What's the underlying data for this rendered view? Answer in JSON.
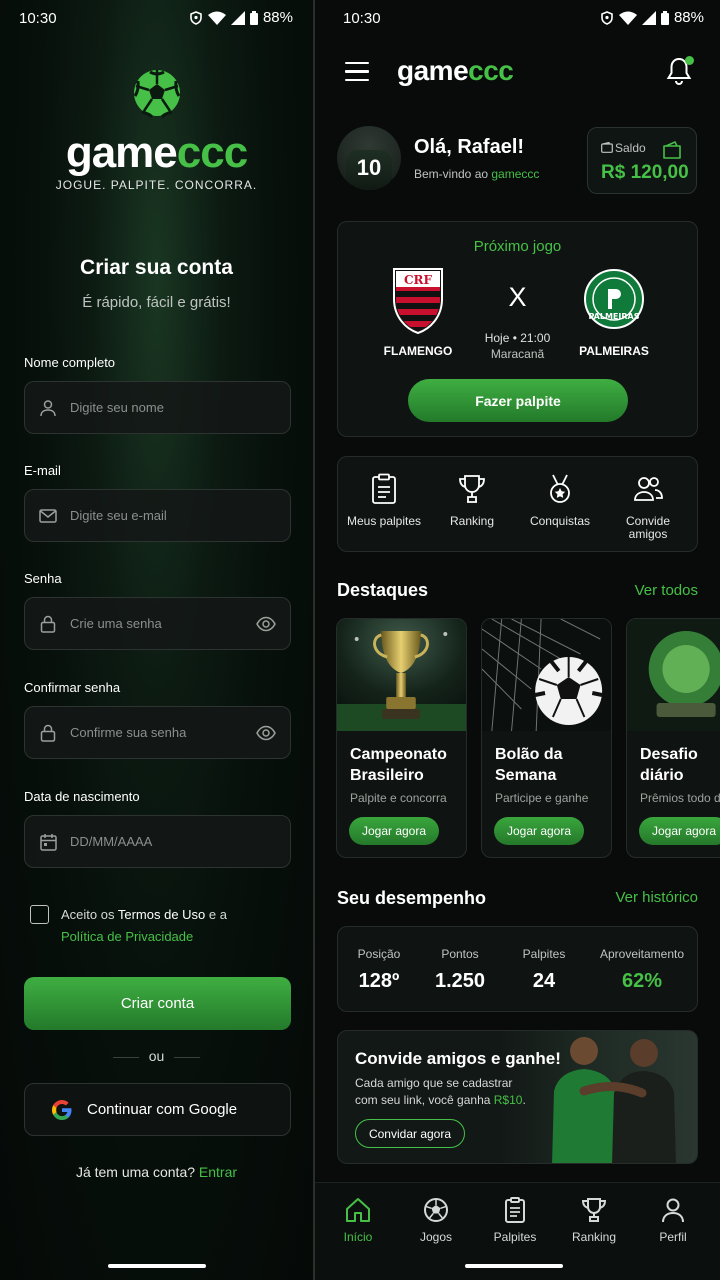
{
  "status_bar": {
    "time": "10:30",
    "battery": "88%"
  },
  "register": {
    "brand": {
      "part1": "game",
      "part2": "ccc",
      "tagline": "JOGUE. PALPITE. CONCORRA."
    },
    "title": "Criar sua conta",
    "subtitle": "É rápido, fácil e grátis!",
    "fields": [
      {
        "label": "Nome completo",
        "placeholder": "Digite seu nome",
        "icon": "user-icon"
      },
      {
        "label": "E-mail",
        "placeholder": "Digite seu e-mail",
        "icon": "mail-icon"
      },
      {
        "label": "Senha",
        "placeholder": "Crie uma senha",
        "icon": "lock-icon"
      },
      {
        "label": "Confirmar senha",
        "placeholder": "Confirme sua senha",
        "icon": "lock-icon"
      },
      {
        "label": "Data de nascimento",
        "placeholder": "DD/MM/AAAA",
        "icon": "calendar-icon"
      }
    ],
    "terms": {
      "prefix": "Aceito os ",
      "terms_link": "Termos de Uso",
      "middle": " e a",
      "privacy_link": "Política de Privacidade"
    },
    "submit_label": "Criar conta",
    "or_label": "ou",
    "google_label": "Continuar com Google",
    "login_prompt": "Já tem uma conta?",
    "login_link": "Entrar"
  },
  "home": {
    "brand": {
      "part1": "game",
      "part2": "ccc"
    },
    "greeting": "Olá, Rafael!",
    "welcome_prefix": "Bem-vindo ao ",
    "welcome_brand": "gameccc",
    "avatar_number": "10",
    "balance": {
      "label": "Saldo",
      "value": "R$ 120,00"
    },
    "next_game": {
      "title": "Próximo jogo",
      "home_team": "FLAMENGO",
      "away_team": "PALMEIRAS",
      "vs": "X",
      "when": "Hoje • 21:00",
      "venue": "Maracanã",
      "cta": "Fazer palpite"
    },
    "quick_actions": [
      {
        "label": "Meus palpites",
        "icon": "clipboard-icon"
      },
      {
        "label": "Ranking",
        "icon": "trophy-icon"
      },
      {
        "label": "Conquistas",
        "icon": "medal-icon"
      },
      {
        "label": "Convide amigos",
        "icon": "friends-icon"
      }
    ],
    "highlights": {
      "title": "Destaques",
      "see_all": "Ver todos",
      "items": [
        {
          "title_line1": "Campeonato",
          "title_line2": "Brasileiro",
          "subtitle": "Palpite e concorra",
          "cta": "Jogar agora"
        },
        {
          "title_line1": "Bolão da",
          "title_line2": "Semana",
          "subtitle": "Participe e ganhe",
          "cta": "Jogar agora"
        },
        {
          "title_line1": "Desafio",
          "title_line2": "diário",
          "subtitle": "Prêmios todo dia",
          "cta": "Jogar agora"
        }
      ]
    },
    "performance": {
      "title": "Seu desempenho",
      "history": "Ver histórico",
      "stats": [
        {
          "label": "Posição",
          "value": "128º"
        },
        {
          "label": "Pontos",
          "value": "1.250"
        },
        {
          "label": "Palpites",
          "value": "24"
        },
        {
          "label": "Aproveitamento",
          "value": "62%"
        }
      ]
    },
    "invite": {
      "title": "Convide amigos e ganhe!",
      "text_prefix": "Cada amigo que se cadastrar com seu link, você ganha ",
      "reward": "R$10",
      "text_suffix": ".",
      "cta": "Convidar agora"
    },
    "tabs": [
      {
        "label": "Início",
        "icon": "home-icon",
        "active": true
      },
      {
        "label": "Jogos",
        "icon": "ball-icon",
        "active": false
      },
      {
        "label": "Palpites",
        "icon": "clipboard-icon",
        "active": false
      },
      {
        "label": "Ranking",
        "icon": "trophy-icon",
        "active": false
      },
      {
        "label": "Perfil",
        "icon": "profile-icon",
        "active": false
      }
    ]
  },
  "colors": {
    "accent": "#46c046",
    "background": "#080b0a",
    "card": "#0f1412"
  }
}
